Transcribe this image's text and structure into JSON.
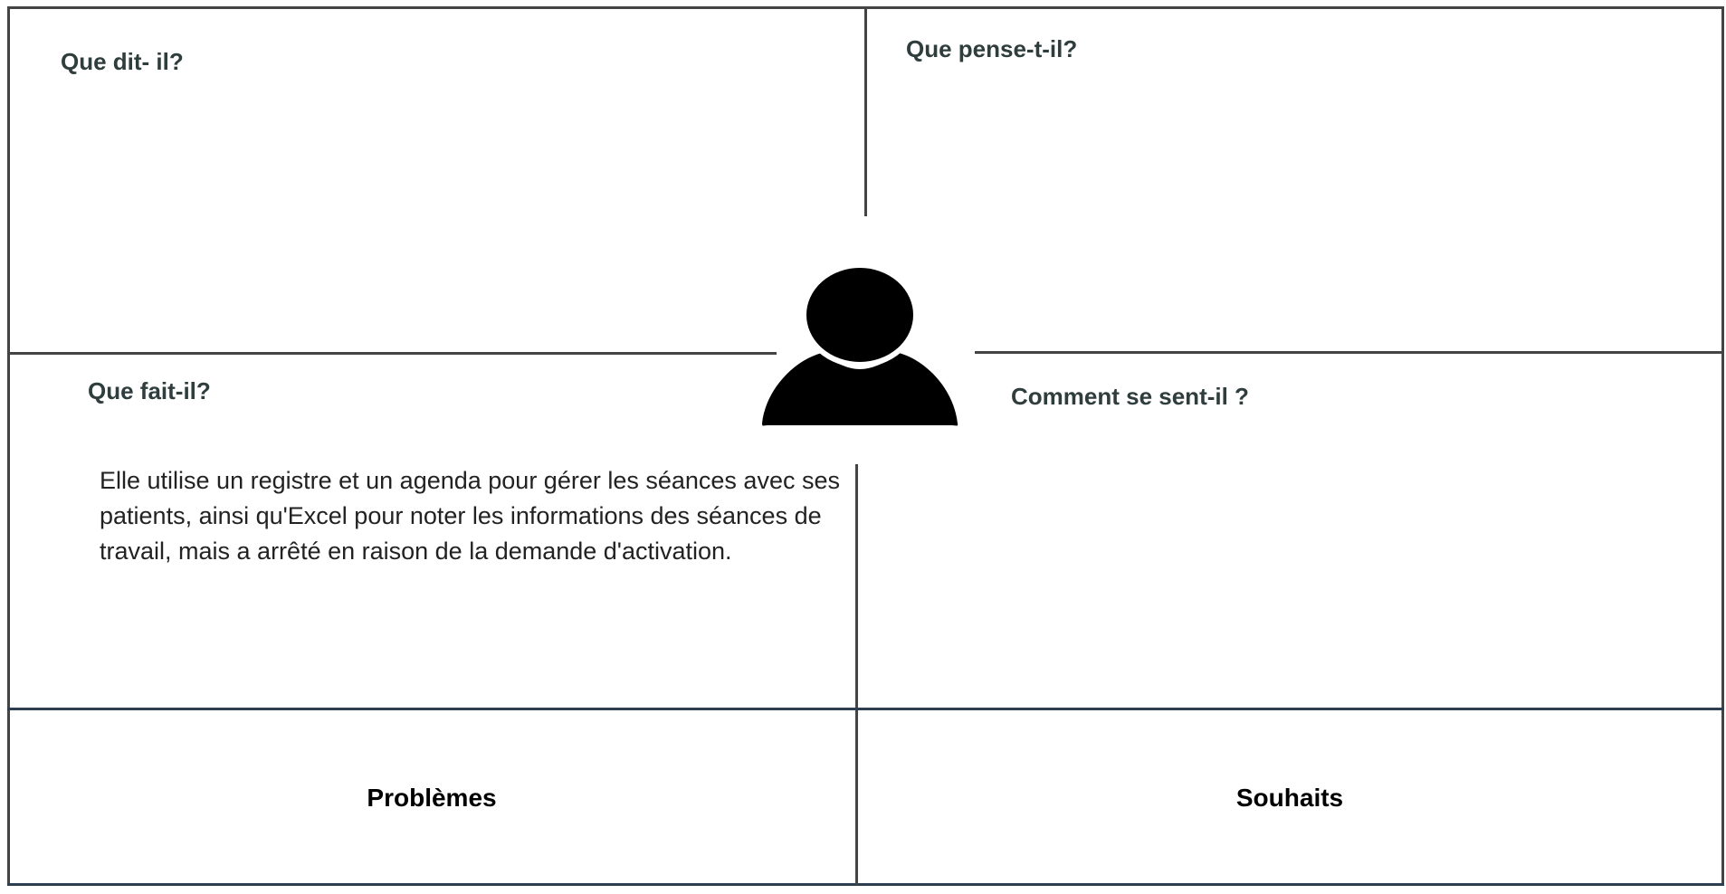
{
  "quadrants": {
    "says": {
      "title": "Que dit- il?"
    },
    "thinks": {
      "title": "Que pense-t-il?"
    },
    "does": {
      "title": "Que fait-il?",
      "content": "Elle utilise un registre et un agenda pour gérer les séances avec ses patients, ainsi qu'Excel pour noter les informations des séances de travail, mais a arrêté en raison de la demande d'activation."
    },
    "feels": {
      "title": "Comment se sent-il ?"
    }
  },
  "bottom": {
    "problems": "Problèmes",
    "wishes": "Souhaits"
  },
  "center_icon": "person-icon",
  "colors": {
    "lines": "#444444",
    "bottom_lines": "#2c3e50",
    "header_text": "#2f3d3d"
  }
}
